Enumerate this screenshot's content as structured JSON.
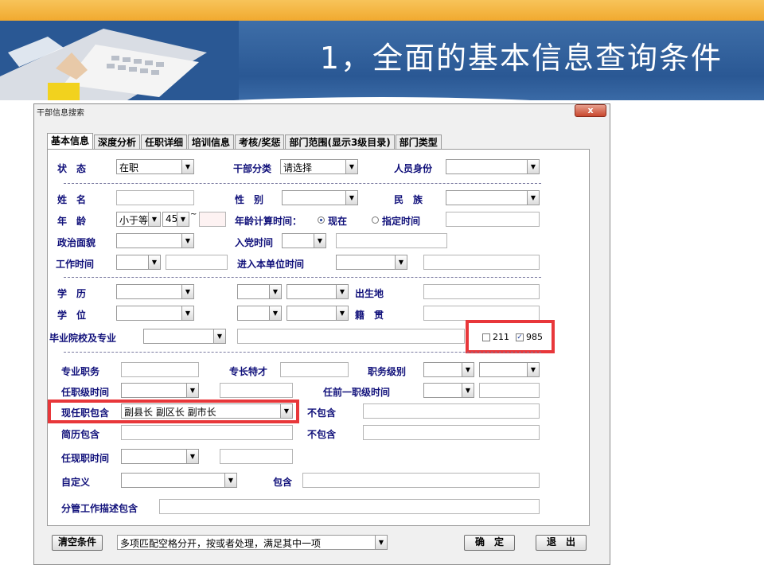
{
  "slide": {
    "title": "1，全面的基本信息查询条件"
  },
  "window": {
    "title": "干部信息搜索",
    "close_glyph": "x"
  },
  "tabs": [
    "基本信息",
    "深度分析",
    "任职详细",
    "培训信息",
    "考核/奖惩",
    "部门范围(显示3级目录)",
    "部门类型"
  ],
  "form": {
    "status_label": "状　态",
    "status_value": "在职",
    "category_label": "干部分类",
    "category_value": "请选择",
    "identity_label": "人员身份",
    "identity_value": "",
    "name_label": "姓　名",
    "name_value": "",
    "gender_label": "性　别",
    "gender_value": "",
    "ethnic_label": "民　族",
    "ethnic_value": "",
    "age_label": "年　龄",
    "age_op": "小于等",
    "age_value": "45",
    "age_tilde": "~",
    "age_to": "",
    "age_calc_label": "年龄计算时间：",
    "age_calc_now": "现在",
    "age_calc_specified": "指定时间",
    "age_calc_date": "",
    "politics_label": "政治面貌",
    "politics_value": "",
    "party_date_label": "入党时间",
    "party_date_value": "",
    "work_date_label": "工作时间",
    "work_date_value": "",
    "unit_date_label": "进入本单位时间",
    "unit_date_value": "",
    "education_label": "学　历",
    "education_value": "",
    "birthplace_label": "出生地",
    "birthplace_value": "",
    "degree_label": "学　位",
    "degree_value": "",
    "native_label": "籍　贯",
    "native_value": "",
    "school_label": "毕业院校及专业",
    "school_value": "",
    "school_major": "",
    "cb_211": "211",
    "cb_985": "985",
    "tech_label": "专业职务",
    "tech_value": "",
    "specialty_label": "专长特才",
    "specialty_value": "",
    "rank_label": "职务级别",
    "rank_value": "",
    "rank_date_label": "任职级时间",
    "rank_date_value": "",
    "prev_rank_date_label": "任前一职级时间",
    "prev_rank_date_value": "",
    "curpos_label": "现任职包含",
    "curpos_value": "副县长 副区长 副市长",
    "exclude_label": "不包含",
    "exclude_value": "",
    "resume_label": "简历包含",
    "resume_value": "",
    "exclude2_label": "不包含",
    "exclude2_value": "",
    "curpos_date_label": "任现职时间",
    "curpos_date_value": "",
    "custom_label": "自定义",
    "custom_value": "",
    "contains_label": "包含",
    "contains_value": "",
    "duty_label": "分管工作描述包含",
    "duty_value": ""
  },
  "footer": {
    "clear_button": "清空条件",
    "match_mode": "多项匹配空格分开，按或者处理，满足其中一项",
    "ok_button": "确　定",
    "exit_button": "退　出"
  },
  "colors": {
    "label_text": "#10107a",
    "highlight": "#e8373a",
    "header_band": "#2a5894",
    "top_bar": "#f1a92f"
  }
}
